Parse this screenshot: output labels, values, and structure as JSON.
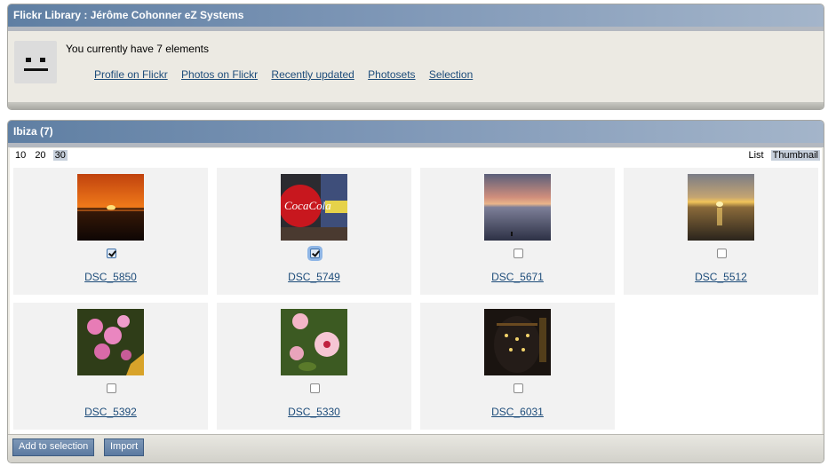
{
  "top_panel": {
    "title": "Flickr Library : Jérôme Cohonner eZ Systems",
    "count_text": "You currently have 7 elements",
    "links": [
      "Profile on Flickr",
      "Photos on Flickr",
      "Recently updated",
      "Photosets",
      "Selection"
    ]
  },
  "album": {
    "title": "Ibiza (7)",
    "pager": [
      "10",
      "20",
      "30"
    ],
    "pager_active": "30",
    "view_modes": [
      "List",
      "Thumbnail"
    ],
    "view_active": "Thumbnail",
    "photos": [
      {
        "name": "DSC_5850",
        "checked": true,
        "subject": "sunset-over-sea"
      },
      {
        "name": "DSC_5749",
        "checked": true,
        "subject": "coca-cola-sign"
      },
      {
        "name": "DSC_5671",
        "checked": false,
        "subject": "dusk-seascape"
      },
      {
        "name": "DSC_5512",
        "checked": false,
        "subject": "golden-sunset"
      },
      {
        "name": "DSC_5392",
        "checked": false,
        "subject": "pink-flowers"
      },
      {
        "name": "DSC_5330",
        "checked": false,
        "subject": "hibiscus-flowers"
      },
      {
        "name": "DSC_6031",
        "checked": false,
        "subject": "dark-lantern"
      }
    ]
  },
  "actions": {
    "add_to_selection": "Add to selection",
    "import": "Import"
  },
  "colors": {
    "header_gradient_start": "#5f7fa3",
    "header_gradient_end": "#a4b5ca",
    "panel_bg": "#eceae3",
    "link": "#1d4c7a",
    "button": "#5b7aa0"
  }
}
